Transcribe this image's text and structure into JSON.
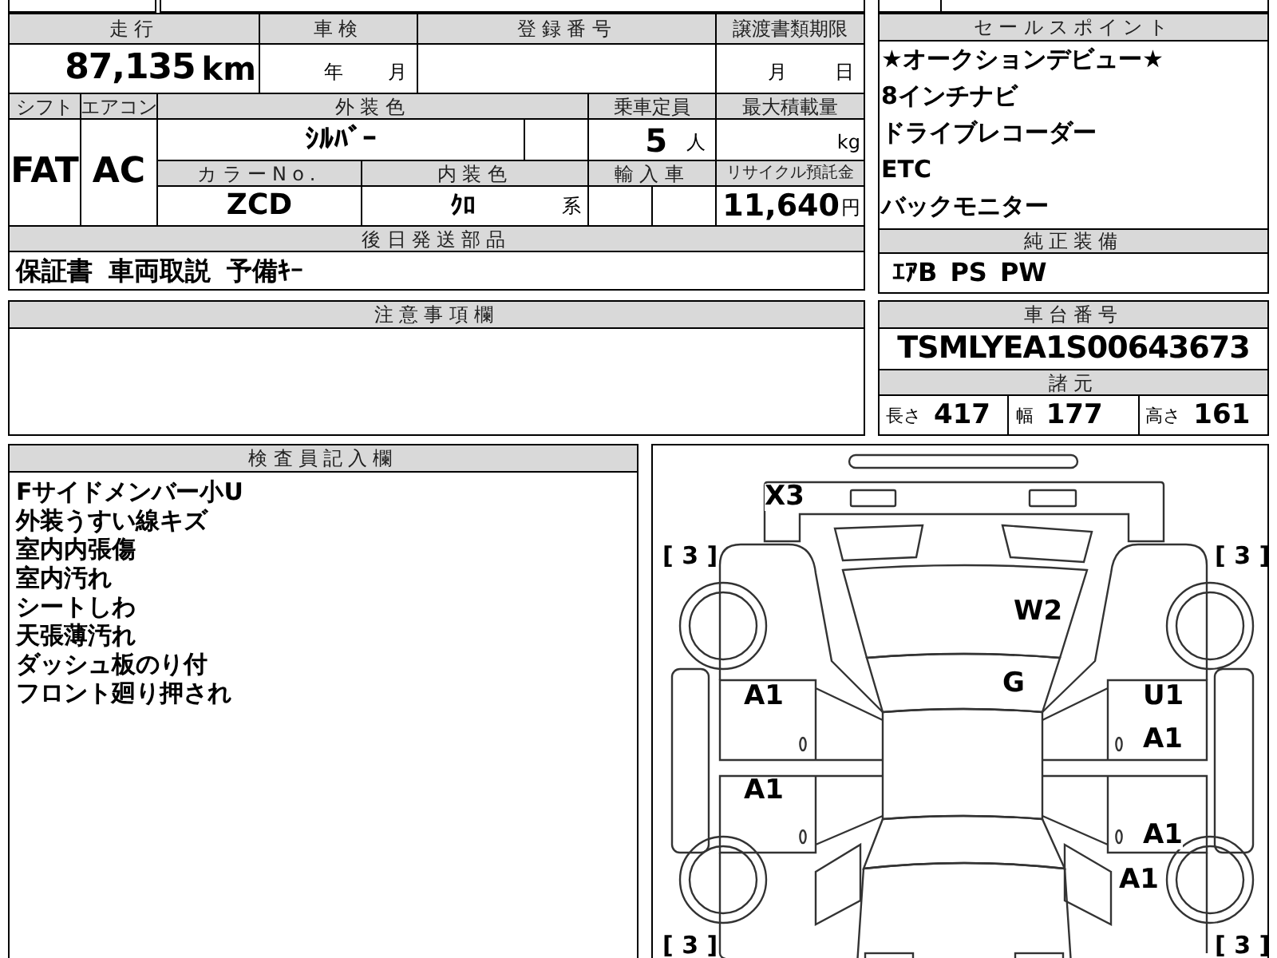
{
  "vehicle_table": {
    "mileage_header": "走行",
    "mileage": "87,135",
    "mileage_unit": "km",
    "inspection_header": "車検",
    "inspection_year": "年",
    "inspection_month": "月",
    "registration_header": "登録番号",
    "transfer_deadline_header": "譲渡書類期限",
    "transfer_month": "月",
    "transfer_day": "日",
    "shift_header": "シフト",
    "shift": "FAT",
    "ac_header": "エアコン",
    "ac": "AC",
    "exterior_color_header": "外装色",
    "exterior_color": "ｼﾙﾊﾞｰ",
    "capacity_header": "乗車定員",
    "capacity": "5",
    "capacity_unit": "人",
    "max_load_header": "最大積載量",
    "max_load_unit": "kg",
    "color_no_header": "カラーNo.",
    "color_no": "ZCD",
    "interior_color_header": "内装色",
    "interior_color": "ｸﾛ",
    "interior_color_suffix": "系",
    "import_header": "輸入車",
    "recycle_fee_header": "リサイクル預託金",
    "recycle_fee": "11,640",
    "recycle_fee_unit": "円"
  },
  "after_shipment_parts": {
    "header": "後日発送部品",
    "items": [
      "保証書",
      "車両取説",
      "予備ｷｰ"
    ]
  },
  "notes": {
    "header": "注意事項欄"
  },
  "sales_points": {
    "header": "セールスポイント",
    "items": [
      "★オークションデビュー★",
      "8インチナビ",
      "ドライブレコーダー",
      "ETC",
      "バックモニター"
    ]
  },
  "standard_equipment": {
    "header": "純正装備",
    "items": [
      "ｴｱB",
      "PS",
      "PW"
    ]
  },
  "chassis": {
    "header": "車台番号",
    "number": "TSMLYEA1S00643673"
  },
  "specs": {
    "header": "諸元",
    "items": [
      {
        "label": "長さ",
        "value": "417"
      },
      {
        "label": "幅",
        "value": "177"
      },
      {
        "label": "高さ",
        "value": "161"
      }
    ]
  },
  "inspector_notes": {
    "header": "検査員記入欄",
    "lines": [
      "Fサイドメンバー小U",
      "外装うすい線キズ",
      "室内内張傷",
      "室内汚れ",
      "シートしわ",
      "天張薄汚れ",
      "ダッシュ板のり付",
      "フロント廻り押され"
    ]
  },
  "damage_diagram": {
    "tire_marks": [
      "[ 3 ]",
      "[ 3 ]",
      "[ 3 ]",
      "[ 3 ]"
    ],
    "damage_marks": [
      "X3",
      "W2",
      "G",
      "A1",
      "U1",
      "A1",
      "A1",
      "A1",
      "A1"
    ]
  }
}
